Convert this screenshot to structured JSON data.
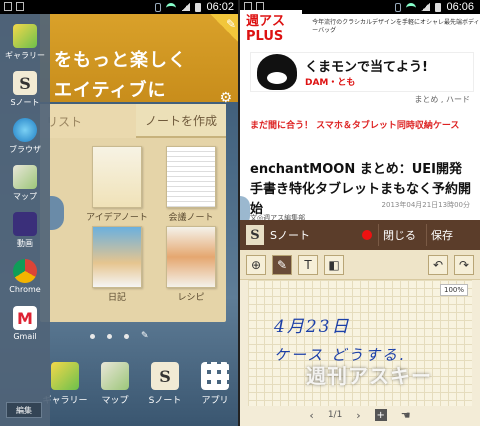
{
  "left_phone": {
    "status": {
      "time": "06:02"
    },
    "banner": {
      "line1": "をもっと楽しく",
      "line2": "エイティブに"
    },
    "notebook": {
      "tabs": [
        "リスト",
        "ノートを作成"
      ],
      "templates": [
        "アイデアノート",
        "会議ノート",
        "日記",
        "レシピ"
      ]
    },
    "sidebar": {
      "items": [
        {
          "label": "ギャラリー",
          "icon": "gallery-icon"
        },
        {
          "label": "Sノート",
          "icon": "snote-icon"
        },
        {
          "label": "ブラウザ",
          "icon": "browser-icon"
        },
        {
          "label": "マップ",
          "icon": "map-icon"
        },
        {
          "label": "動画",
          "icon": "video-icon"
        },
        {
          "label": "Chrome",
          "icon": "chrome-icon"
        },
        {
          "label": "Gmail",
          "icon": "gmail-icon"
        }
      ],
      "edit_label": "編集"
    },
    "dock": [
      {
        "label": "ギャラリー",
        "icon": "gallery-icon"
      },
      {
        "label": "マップ",
        "icon": "map-icon"
      },
      {
        "label": "Sノート",
        "icon": "snote-icon"
      },
      {
        "label": "アプリ",
        "icon": "apps-icon"
      }
    ]
  },
  "right_phone": {
    "status": {
      "time": "06:06"
    },
    "ad": {
      "logo": "週アス PLUS",
      "text": "今年流行のクラシカルデザインを手軽にオシャレ最先端ボディーバッグ"
    },
    "kumamon": {
      "title": "くまモンで当てよう!",
      "sub": "DAM・とも"
    },
    "sub_nav": "まとめ , ハード",
    "red_link": "まだ間に合う！ スマホ＆タブレット同時収納ケース",
    "article": {
      "title": "enchantMOON まとめ：UEI開発 手書き特化タブレットまもなく予約開始",
      "meta": "2013年04月21日13時00分",
      "author": "文◎週アス編集部"
    },
    "popup": {
      "title": "Sノート",
      "close_label": "閉じる",
      "save_label": "保存",
      "zoom": "100%",
      "handwriting1": "4月23日",
      "handwriting2": "ケース どうする.",
      "page_indicator": "1/1",
      "watermark": "週刊アスキー"
    }
  }
}
